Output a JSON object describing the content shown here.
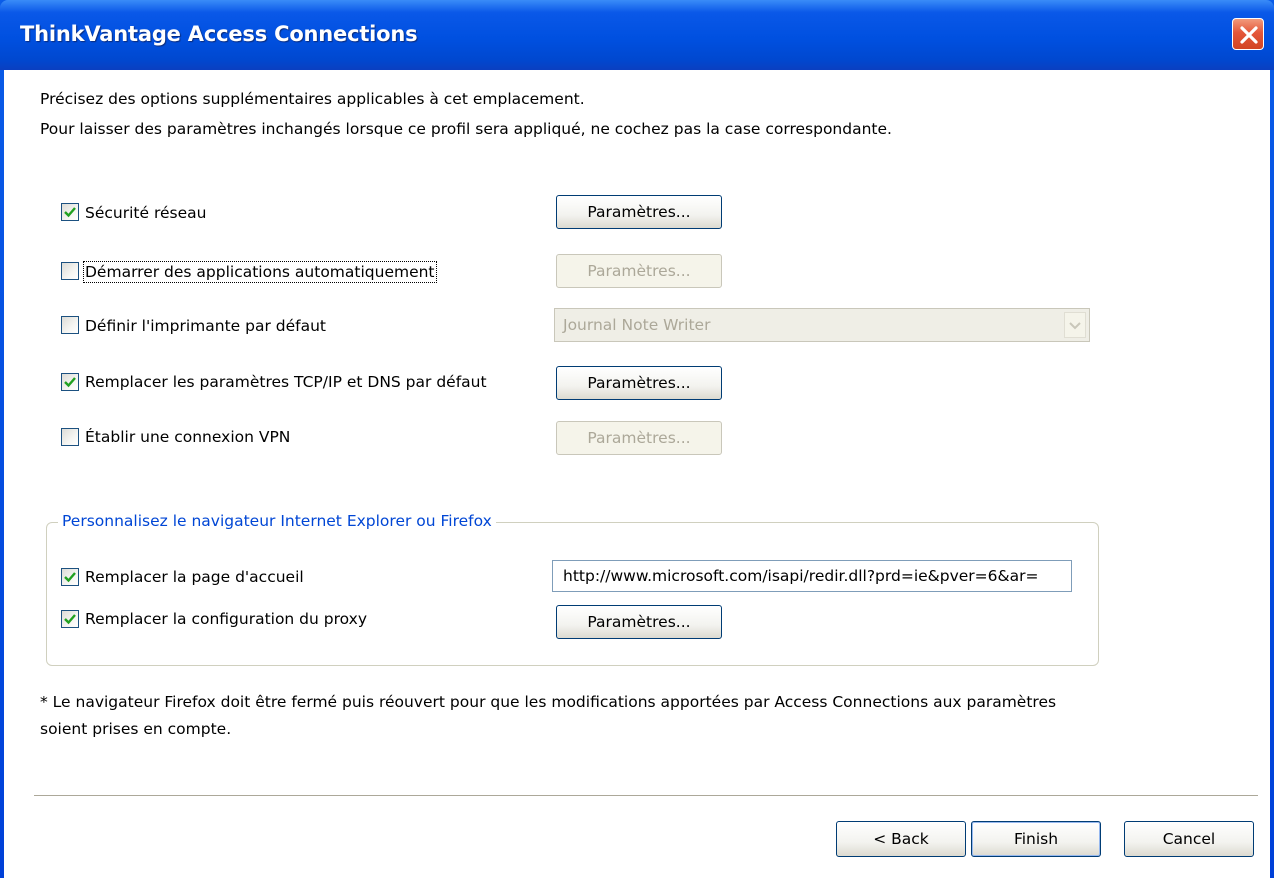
{
  "window": {
    "title": "ThinkVantage Access Connections"
  },
  "intro": {
    "line1": "Précisez des options supplémentaires applicables à cet emplacement.",
    "line2": "Pour laisser des paramètres inchangés lorsque ce profil sera appliqué, ne cochez pas la case correspondante."
  },
  "options": [
    {
      "label": "Sécurité réseau",
      "checked": true,
      "button": "Paramètres...",
      "button_enabled": true
    },
    {
      "label": "Démarrer des applications automatiquement",
      "checked": false,
      "button": "Paramètres...",
      "button_enabled": false
    },
    {
      "label": "Définir l'imprimante par défaut",
      "checked": false,
      "select_value": "Journal Note Writer",
      "select_enabled": false
    },
    {
      "label": "Remplacer les paramètres TCP/IP et DNS par défaut",
      "checked": true,
      "button": "Paramètres...",
      "button_enabled": true
    },
    {
      "label": "Établir une connexion VPN",
      "checked": false,
      "button": "Paramètres...",
      "button_enabled": false
    }
  ],
  "browser_group": {
    "title": "Personnalisez le navigateur Internet Explorer ou Firefox",
    "home_page_label": "Remplacer la page d'accueil",
    "home_page_checked": true,
    "home_page_url": "http://www.microsoft.com/isapi/redir.dll?prd=ie&pver=6&ar=",
    "proxy_label": "Remplacer la configuration du proxy",
    "proxy_checked": true,
    "proxy_button": "Paramètres..."
  },
  "note": {
    "line1": "* Le navigateur Firefox doit être fermé puis réouvert pour que les modifications apportées par Access Connections aux paramètres",
    "line2": "soient prises en compte."
  },
  "footer": {
    "back_label": "< Back",
    "finish_label": "Finish",
    "cancel_label": "Cancel"
  },
  "colors": {
    "title_bar": "#0050e0",
    "close_button": "#e4573a",
    "group_title": "#0046d5",
    "check_mark": "#21a121"
  },
  "icons": {
    "close": "close-x-icon",
    "check": "check-mark-icon",
    "dropdown": "chevron-down-icon"
  }
}
